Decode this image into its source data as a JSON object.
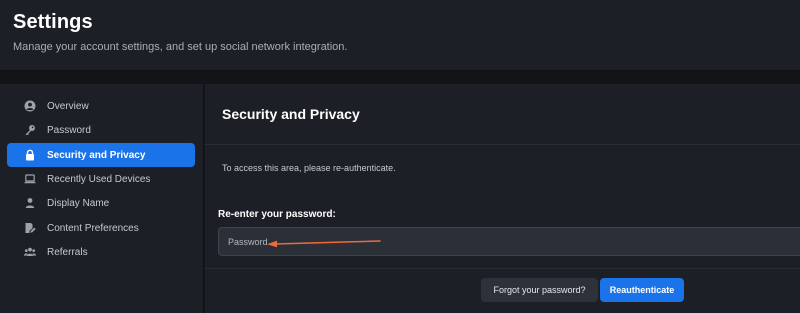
{
  "header": {
    "title": "Settings",
    "subtitle": "Manage your account settings, and set up social network integration."
  },
  "sidebar": {
    "items": [
      {
        "label": "Overview",
        "icon": "user-circle-icon",
        "active": false
      },
      {
        "label": "Password",
        "icon": "key-icon",
        "active": false
      },
      {
        "label": "Security and Privacy",
        "icon": "lock-icon",
        "active": true
      },
      {
        "label": "Recently Used Devices",
        "icon": "laptop-icon",
        "active": false
      },
      {
        "label": "Display Name",
        "icon": "person-icon",
        "active": false
      },
      {
        "label": "Content Preferences",
        "icon": "edit-document-icon",
        "active": false
      },
      {
        "label": "Referrals",
        "icon": "group-icon",
        "active": false
      }
    ]
  },
  "main": {
    "section_title": "Security and Privacy",
    "info_text": "To access this area, please re-authenticate.",
    "field_label": "Re-enter your password:",
    "password_value": "",
    "password_placeholder": "Password",
    "forgot_label": "Forgot your password?",
    "reauth_label": "Reauthenticate"
  },
  "colors": {
    "accent": "#1a73e8",
    "background": "#1c1f26",
    "annotation_arrow": "#f0693a"
  }
}
